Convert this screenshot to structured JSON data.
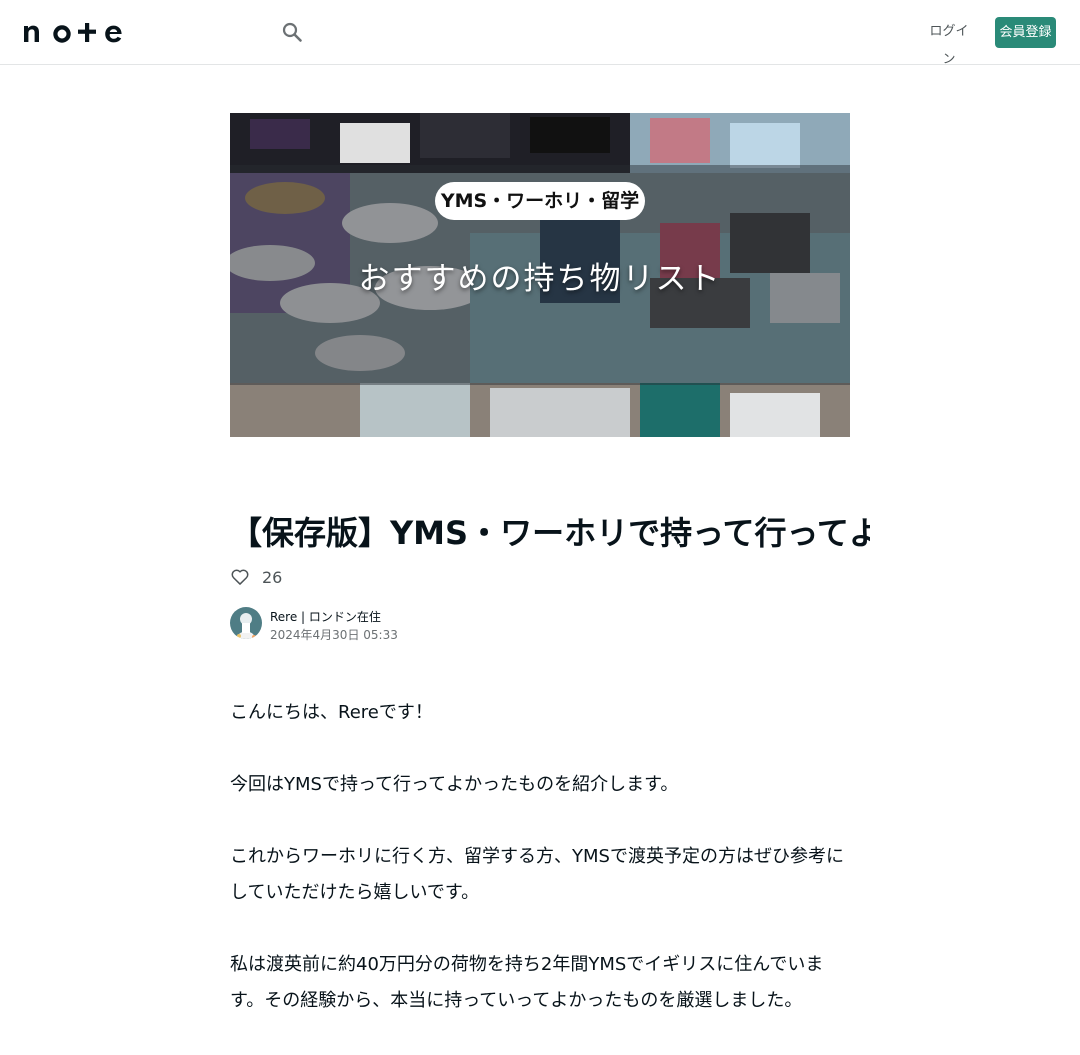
{
  "header": {
    "logo_text": "note",
    "login_label": "ログイン",
    "signup_label": "会員登録"
  },
  "hero": {
    "pill_text": "YMS・ワーホリ・留学",
    "title_text": "おすすめの持ち物リスト"
  },
  "article": {
    "title": "【保存版】YMS・ワーホリで持って行ってよかったもの全部紹介",
    "like_count": "26",
    "author_name": "Rere | ロンドン在住",
    "date": "2024年4月30日 05:33",
    "paragraphs": [
      "こんにちは、Rereです！",
      "今回はYMSで持って行ってよかったものを紹介します。",
      "これからワーホリに行く方、留学する方、YMSで渡英予定の方はぜひ参考にしていただけたら嬉しいです。",
      "私は渡英前に約40万円分の荷物を持ち2年間YMSでイギリスに住んでいます。その経験から、本当に持っていってよかったものを厳選しました。"
    ]
  },
  "colors": {
    "brand": "#2a8a78",
    "text": "#08131a",
    "muted": "#6c7174"
  }
}
